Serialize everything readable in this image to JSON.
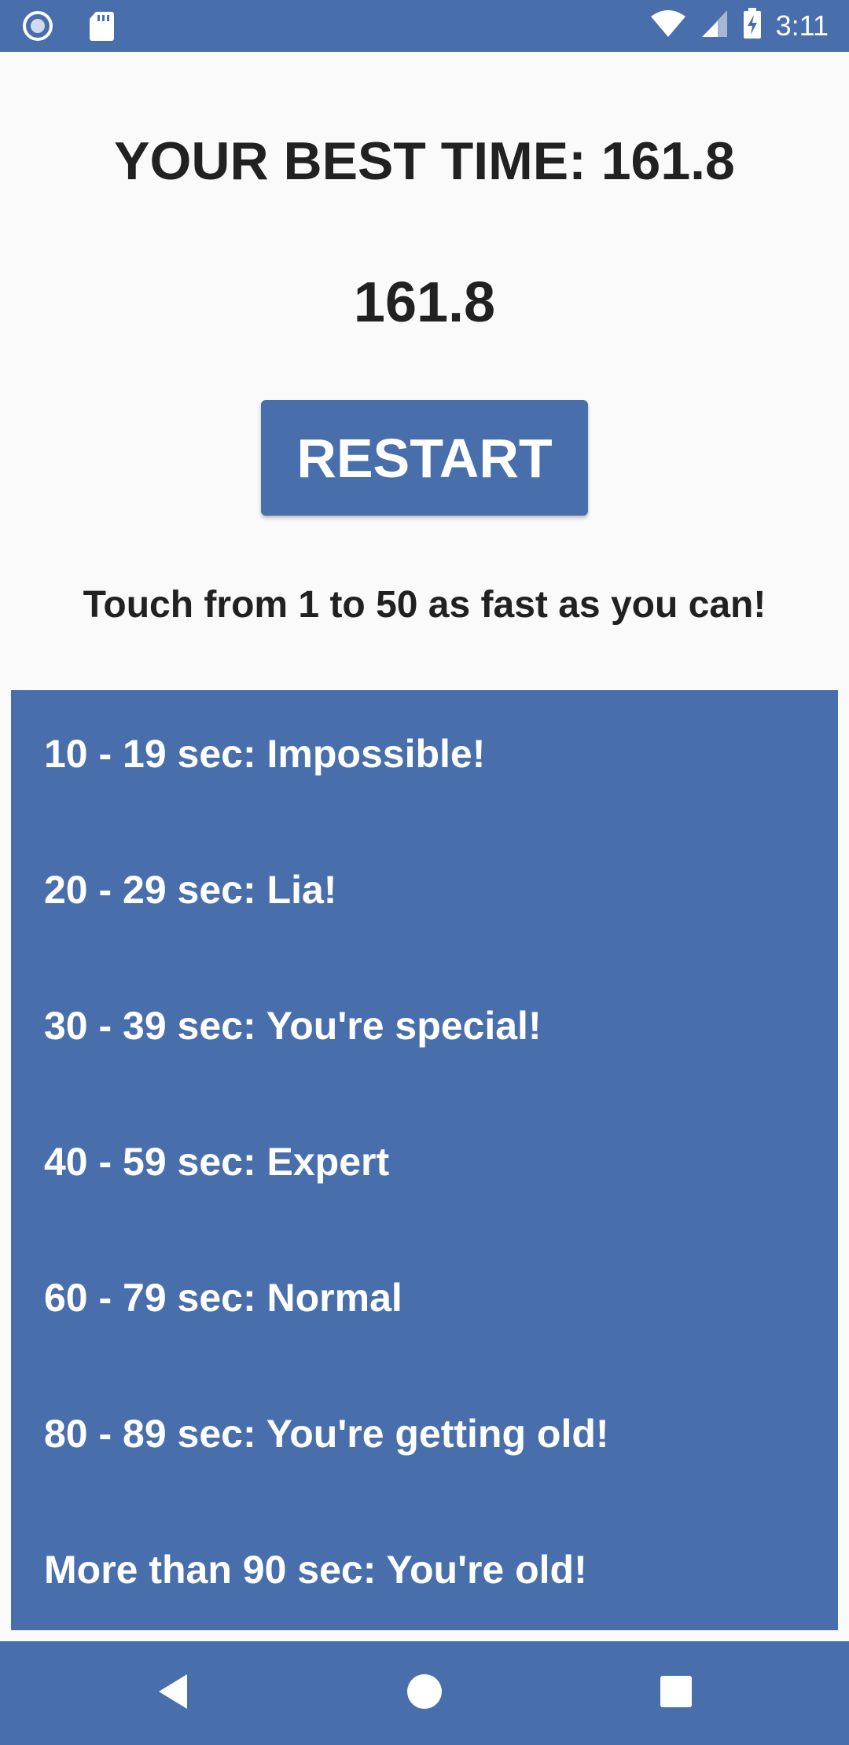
{
  "colors": {
    "primary": "#486eab",
    "background": "#fafafa",
    "text": "#212121",
    "on_primary": "#ffffff"
  },
  "status_bar": {
    "time": "3:11",
    "left_icons": [
      "circle-notification-icon",
      "sd-card-icon"
    ],
    "right_icons": [
      "wifi-icon",
      "cell-signal-icon",
      "battery-charging-icon"
    ]
  },
  "header": {
    "best_time_text": "YOUR BEST TIME: 161.8",
    "current_time": "161.8"
  },
  "restart_button": {
    "label": "RESTART"
  },
  "instruction": "Touch from 1 to 50 as fast as you can!",
  "ranking": [
    "10 - 19 sec: Impossible!",
    "20 - 29 sec: Lia!",
    "30 - 39 sec: You're special!",
    "40 - 59 sec: Expert",
    "60 - 79 sec: Normal",
    "80 - 89 sec: You're getting old!",
    "More than 90 sec: You're old!"
  ],
  "nav_bar": {
    "icons": [
      "back-icon",
      "home-icon",
      "recents-icon"
    ]
  }
}
